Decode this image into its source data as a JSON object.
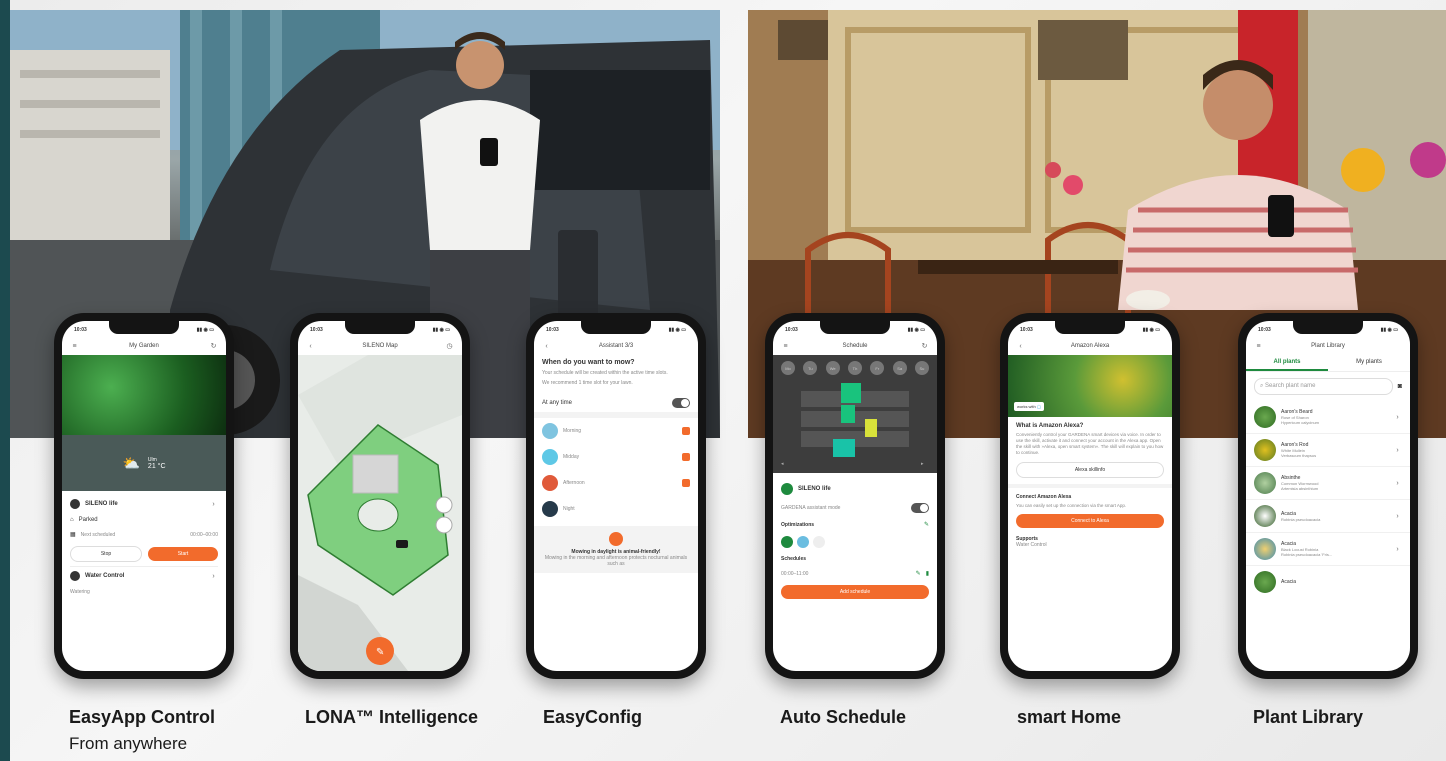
{
  "colors": {
    "accent": "#f26b2c",
    "teal": "#1c4a4f",
    "green": "#1e8a3e"
  },
  "phones": [
    {
      "title": "My Garden",
      "time": "10:03",
      "weather_city": "Ulm",
      "weather_temp": "21 °C",
      "device": "SILENO life",
      "status": "Parked",
      "next": "Next scheduled",
      "next_time": "00:00–00:00",
      "stop": "Stop",
      "start": "Start",
      "water": "Water Control",
      "watering": "Watering"
    },
    {
      "title": "SILENO Map",
      "time": "10:03"
    },
    {
      "title": "Assistant 3/3",
      "time": "10:03",
      "question": "When do you want to mow?",
      "text1": "Your schedule will be created within the active time slots.",
      "text2": "We recommend 1 time slot for your lawn.",
      "anytime": "At any time",
      "slots": [
        "Morning",
        "Midday",
        "Afternoon",
        "Night"
      ],
      "tip_title": "Mowing in daylight is animal-friendly!",
      "tip_text": "Mowing in the morning and afternoon protects nocturnal animals such as"
    },
    {
      "title": "Schedule",
      "time": "10:03",
      "days": [
        "Mo",
        "Tu",
        "We",
        "Th",
        "Fr",
        "Sa",
        "Su"
      ],
      "device": "SILENO life",
      "assist": "GARDENA assistant mode",
      "options": "Optimizations",
      "schedules": "Schedules",
      "sched_time": "00:00–11:00",
      "add": "Add schedule"
    },
    {
      "title": "Amazon Alexa",
      "time": "10:03",
      "works": "works with",
      "question": "What is Amazon Alexa?",
      "text": "Conveniently control your GARDENA smart devices via voice. In order to use the skill, activate it and connect your account in the Alexa app. Open the skill with »Alexa, open smart system«. The skill will explain to you how to continue.",
      "skill": "Alexa skillinfo",
      "connect_title": "Connect Amazon Alexa",
      "connect_text": "You can easily set up the connection via the smart App.",
      "connect_btn": "Connect to Alexa",
      "supports": "Supports",
      "water": "Water Control"
    },
    {
      "title": "Plant Library",
      "time": "10:03",
      "tab_all": "All plants",
      "tab_my": "My plants",
      "search": "Search plant name",
      "plants": [
        {
          "name": "Aaron's Beard",
          "sub1": "Rose of Sharon",
          "sub2": "Hypericum calycinum"
        },
        {
          "name": "Aaron's Rod",
          "sub1": "White Mullein",
          "sub2": "Verbascum thapsus"
        },
        {
          "name": "Absinthe",
          "sub1": "Common Wormwood",
          "sub2": "Artemisia absinthium"
        },
        {
          "name": "Acacia",
          "sub1": "Robinia pseudoacacia",
          "sub2": ""
        },
        {
          "name": "Acacia",
          "sub1": "Black Locust Robinia",
          "sub2": "Robinia pseudoacacia 'Fris..."
        },
        {
          "name": "Acacia",
          "sub1": "",
          "sub2": ""
        }
      ]
    }
  ],
  "captions": {
    "c1": "EasyApp Control",
    "c1_sub": "From anywhere",
    "c2": "LONA™ Intelligence",
    "c3": "EasyConfig",
    "c4": "Auto Schedule",
    "c5": "smart Home",
    "c6": "Plant Library"
  }
}
